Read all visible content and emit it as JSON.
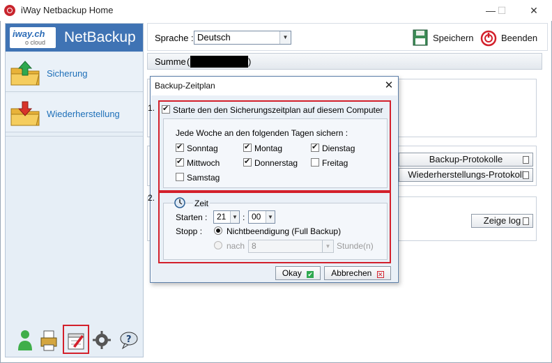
{
  "window": {
    "title": "iWay Netbackup Home",
    "controls": [
      "—",
      "☐",
      "✕"
    ]
  },
  "brand": {
    "logo_main": "iway.ch",
    "logo_sub": "o cloud",
    "title": "NetBackup"
  },
  "sidebar": {
    "items": [
      {
        "label": "Sicherung"
      },
      {
        "label": "Wiederherstellung"
      }
    ]
  },
  "toolbar": {
    "language_label": "Sprache :",
    "language_value": "Deutsch",
    "save_label": "Speichern",
    "quit_label": "Beenden"
  },
  "main": {
    "summe_label": "Summe",
    "backup_log_button": "Backup-Protokolle",
    "restore_log_button": "Wiederherstellungs-Protokoll",
    "show_log_button": "Zeige log"
  },
  "dialog": {
    "title": "Backup-Zeitplan",
    "close_label": "✕",
    "step1": "1.",
    "step2": "2.",
    "enable_label": "Starte den den Sicherungszeitplan auf diesem Computer",
    "enable_checked": true,
    "weekly_label": "Jede Woche an den folgenden Tagen sichern :",
    "days": [
      {
        "label": "Sonntag",
        "checked": true
      },
      {
        "label": "Montag",
        "checked": true
      },
      {
        "label": "Dienstag",
        "checked": true
      },
      {
        "label": "Mittwoch",
        "checked": true
      },
      {
        "label": "Donnerstag",
        "checked": true
      },
      {
        "label": "Freitag",
        "checked": false
      },
      {
        "label": "Samstag",
        "checked": false
      }
    ],
    "time_section_label": "Zeit",
    "start_label": "Starten :",
    "start_hour": "21",
    "start_separator": ":",
    "start_minute": "00",
    "stop_label": "Stopp :",
    "stop_option1": "Nichtbeendigung (Full Backup)",
    "stop_option2_prefix": "nach",
    "stop_option2_value": "8",
    "stop_option2_suffix": "Stunde(n)",
    "ok_label": "Okay",
    "cancel_label": "Abbrechen"
  },
  "colors": {
    "brand_blue": "#3f73b4",
    "link_blue": "#1e6fb8",
    "highlight_red": "#d3202b"
  }
}
